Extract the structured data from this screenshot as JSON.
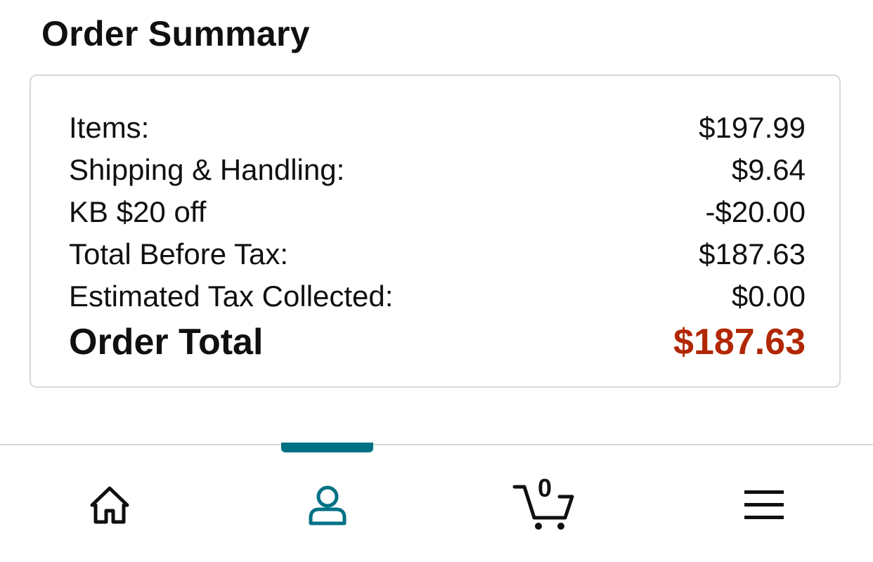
{
  "page": {
    "title": "Order Summary"
  },
  "summary": {
    "rows": [
      {
        "label": "Items:",
        "value": "$197.99"
      },
      {
        "label": "Shipping & Handling:",
        "value": "$9.64"
      },
      {
        "label": "KB $20 off",
        "value": "-$20.00"
      },
      {
        "label": "Total Before Tax:",
        "value": "$187.63"
      },
      {
        "label": "Estimated Tax Collected:",
        "value": "$0.00"
      }
    ],
    "order_total": {
      "label": "Order Total",
      "value": "$187.63",
      "color": "#b12704"
    }
  },
  "bottom_nav": {
    "active_tab": "account",
    "accent_color": "#007185",
    "items": [
      {
        "name": "home",
        "icon": "home-icon"
      },
      {
        "name": "account",
        "icon": "person-icon"
      },
      {
        "name": "cart",
        "icon": "cart-icon",
        "count": "0"
      },
      {
        "name": "menu",
        "icon": "hamburger-menu-icon"
      }
    ]
  }
}
